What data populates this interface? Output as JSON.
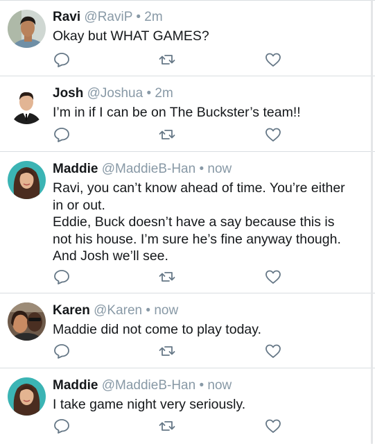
{
  "tweets": [
    {
      "name": "Ravi",
      "handle": "@RaviP",
      "time": "2m",
      "lines": [
        "Okay but WHAT GAMES?"
      ]
    },
    {
      "name": "Josh",
      "handle": "@Joshua",
      "time": "2m",
      "lines": [
        "I’m in if I can be on The Buckster’s team!!"
      ]
    },
    {
      "name": "Maddie",
      "handle": "@MaddieB-Han",
      "time": "now",
      "lines": [
        "Ravi, you can’t know ahead of time. You’re either",
        "in or out.",
        "Eddie, Buck doesn’t have a say because this is",
        "not his house. I’m sure he’s fine anyway though.",
        "And Josh we’ll see."
      ]
    },
    {
      "name": "Karen",
      "handle": "@Karen",
      "time": "now",
      "lines": [
        "Maddie did not come to play today."
      ]
    },
    {
      "name": "Maddie",
      "handle": "@MaddieB-Han",
      "time": "now",
      "lines": [
        "I take game night very seriously."
      ]
    }
  ],
  "separator": "•",
  "colors": {
    "text": "#14171a",
    "secondary": "#8899a6",
    "divider": "#d9dde1",
    "icon": "#657786"
  },
  "icons": {
    "reply": "speech-bubble-icon",
    "retweet": "retweet-icon",
    "like": "heart-icon"
  }
}
